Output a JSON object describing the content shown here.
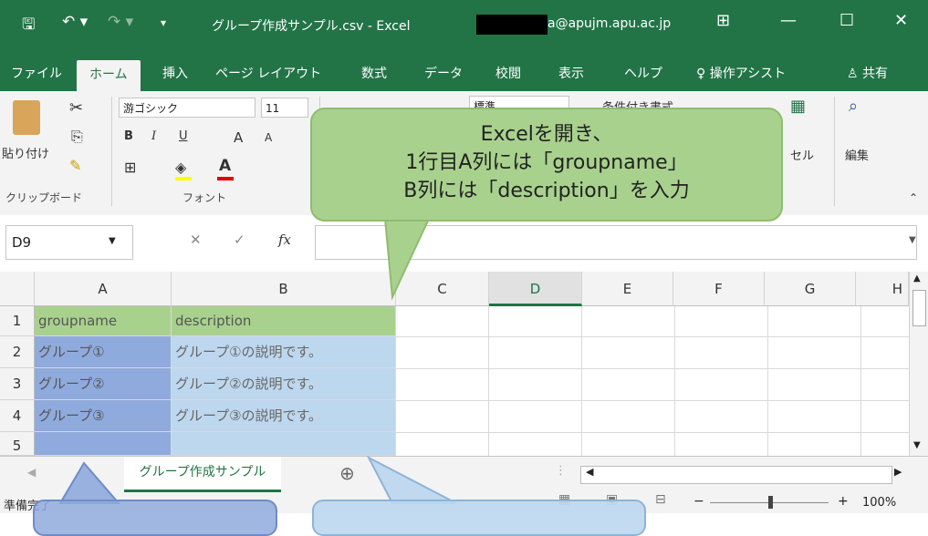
{
  "titlebar": {
    "quick_access": {
      "save": "🖫",
      "undo": "↶ ▾",
      "redo": "↷ ▾",
      "customize": "▾"
    },
    "title": "グループ作成サンプル.csv  -  Excel",
    "account_email": "a@apujm.apu.ac.jp",
    "display_options": "⊞",
    "minimize": "—",
    "maximize": "☐",
    "close": "✕"
  },
  "menu": {
    "tabs": [
      "ファイル",
      "ホーム",
      "挿入",
      "ページ レイアウト",
      "数式",
      "データ",
      "校閲",
      "表示",
      "ヘルプ"
    ],
    "active_tab": "ホーム",
    "tell_me": "操作アシスト",
    "share": "共有"
  },
  "ribbon": {
    "clipboard": {
      "paste": "貼り付け",
      "group": "クリップボード"
    },
    "font": {
      "name": "游ゴシック",
      "size": "11",
      "bold": "B",
      "italic": "I",
      "underline": "U",
      "grow": "A",
      "shrink": "A",
      "group": "フォント"
    },
    "number_format": "標準",
    "conditional_format": "条件付き書式",
    "cells": "セル",
    "editing": "編集"
  },
  "formula_bar": {
    "name_box": "D9",
    "cancel": "✕",
    "enter": "✓",
    "fx": "fx",
    "content": ""
  },
  "sheet": {
    "columns": [
      "A",
      "B",
      "C",
      "D",
      "E",
      "F",
      "G",
      "H"
    ],
    "selected_column": "D",
    "rows": [
      {
        "num": "1",
        "a": "groupname",
        "b": "description"
      },
      {
        "num": "2",
        "a": "グループ①",
        "b": "グループ①の説明です。"
      },
      {
        "num": "3",
        "a": "グループ②",
        "b": "グループ②の説明です。"
      },
      {
        "num": "4",
        "a": "グループ③",
        "b": "グループ③の説明です。"
      },
      {
        "num": "5",
        "a": "",
        "b": ""
      }
    ],
    "tab_name": "グループ作成サンプル",
    "add_sheet": "⊕"
  },
  "status": {
    "left": "準備完了",
    "zoom": "100%",
    "zoom_minus": "−",
    "zoom_plus": "+"
  },
  "callout": {
    "line1": "Excelを開き、",
    "line2": "1行目A列には「groupname」",
    "line3": "B列には「description」を入力"
  },
  "colors": {
    "excel_green": "#227447",
    "callout_green": "#a9d18e",
    "row1_fill": "#a9d18e",
    "colA_fill": "#8faadc",
    "colB_fill": "#bdd7ee"
  }
}
